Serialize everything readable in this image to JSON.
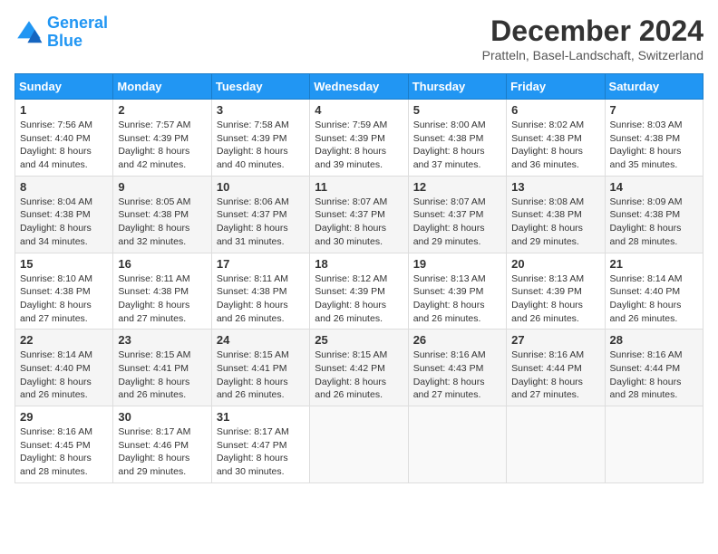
{
  "header": {
    "logo_general": "General",
    "logo_blue": "Blue",
    "month": "December 2024",
    "location": "Pratteln, Basel-Landschaft, Switzerland"
  },
  "columns": [
    "Sunday",
    "Monday",
    "Tuesday",
    "Wednesday",
    "Thursday",
    "Friday",
    "Saturday"
  ],
  "weeks": [
    [
      {
        "day": "1",
        "info": "Sunrise: 7:56 AM\nSunset: 4:40 PM\nDaylight: 8 hours\nand 44 minutes."
      },
      {
        "day": "2",
        "info": "Sunrise: 7:57 AM\nSunset: 4:39 PM\nDaylight: 8 hours\nand 42 minutes."
      },
      {
        "day": "3",
        "info": "Sunrise: 7:58 AM\nSunset: 4:39 PM\nDaylight: 8 hours\nand 40 minutes."
      },
      {
        "day": "4",
        "info": "Sunrise: 7:59 AM\nSunset: 4:39 PM\nDaylight: 8 hours\nand 39 minutes."
      },
      {
        "day": "5",
        "info": "Sunrise: 8:00 AM\nSunset: 4:38 PM\nDaylight: 8 hours\nand 37 minutes."
      },
      {
        "day": "6",
        "info": "Sunrise: 8:02 AM\nSunset: 4:38 PM\nDaylight: 8 hours\nand 36 minutes."
      },
      {
        "day": "7",
        "info": "Sunrise: 8:03 AM\nSunset: 4:38 PM\nDaylight: 8 hours\nand 35 minutes."
      }
    ],
    [
      {
        "day": "8",
        "info": "Sunrise: 8:04 AM\nSunset: 4:38 PM\nDaylight: 8 hours\nand 34 minutes."
      },
      {
        "day": "9",
        "info": "Sunrise: 8:05 AM\nSunset: 4:38 PM\nDaylight: 8 hours\nand 32 minutes."
      },
      {
        "day": "10",
        "info": "Sunrise: 8:06 AM\nSunset: 4:37 PM\nDaylight: 8 hours\nand 31 minutes."
      },
      {
        "day": "11",
        "info": "Sunrise: 8:07 AM\nSunset: 4:37 PM\nDaylight: 8 hours\nand 30 minutes."
      },
      {
        "day": "12",
        "info": "Sunrise: 8:07 AM\nSunset: 4:37 PM\nDaylight: 8 hours\nand 29 minutes."
      },
      {
        "day": "13",
        "info": "Sunrise: 8:08 AM\nSunset: 4:38 PM\nDaylight: 8 hours\nand 29 minutes."
      },
      {
        "day": "14",
        "info": "Sunrise: 8:09 AM\nSunset: 4:38 PM\nDaylight: 8 hours\nand 28 minutes."
      }
    ],
    [
      {
        "day": "15",
        "info": "Sunrise: 8:10 AM\nSunset: 4:38 PM\nDaylight: 8 hours\nand 27 minutes."
      },
      {
        "day": "16",
        "info": "Sunrise: 8:11 AM\nSunset: 4:38 PM\nDaylight: 8 hours\nand 27 minutes."
      },
      {
        "day": "17",
        "info": "Sunrise: 8:11 AM\nSunset: 4:38 PM\nDaylight: 8 hours\nand 26 minutes."
      },
      {
        "day": "18",
        "info": "Sunrise: 8:12 AM\nSunset: 4:39 PM\nDaylight: 8 hours\nand 26 minutes."
      },
      {
        "day": "19",
        "info": "Sunrise: 8:13 AM\nSunset: 4:39 PM\nDaylight: 8 hours\nand 26 minutes."
      },
      {
        "day": "20",
        "info": "Sunrise: 8:13 AM\nSunset: 4:39 PM\nDaylight: 8 hours\nand 26 minutes."
      },
      {
        "day": "21",
        "info": "Sunrise: 8:14 AM\nSunset: 4:40 PM\nDaylight: 8 hours\nand 26 minutes."
      }
    ],
    [
      {
        "day": "22",
        "info": "Sunrise: 8:14 AM\nSunset: 4:40 PM\nDaylight: 8 hours\nand 26 minutes."
      },
      {
        "day": "23",
        "info": "Sunrise: 8:15 AM\nSunset: 4:41 PM\nDaylight: 8 hours\nand 26 minutes."
      },
      {
        "day": "24",
        "info": "Sunrise: 8:15 AM\nSunset: 4:41 PM\nDaylight: 8 hours\nand 26 minutes."
      },
      {
        "day": "25",
        "info": "Sunrise: 8:15 AM\nSunset: 4:42 PM\nDaylight: 8 hours\nand 26 minutes."
      },
      {
        "day": "26",
        "info": "Sunrise: 8:16 AM\nSunset: 4:43 PM\nDaylight: 8 hours\nand 27 minutes."
      },
      {
        "day": "27",
        "info": "Sunrise: 8:16 AM\nSunset: 4:44 PM\nDaylight: 8 hours\nand 27 minutes."
      },
      {
        "day": "28",
        "info": "Sunrise: 8:16 AM\nSunset: 4:44 PM\nDaylight: 8 hours\nand 28 minutes."
      }
    ],
    [
      {
        "day": "29",
        "info": "Sunrise: 8:16 AM\nSunset: 4:45 PM\nDaylight: 8 hours\nand 28 minutes."
      },
      {
        "day": "30",
        "info": "Sunrise: 8:17 AM\nSunset: 4:46 PM\nDaylight: 8 hours\nand 29 minutes."
      },
      {
        "day": "31",
        "info": "Sunrise: 8:17 AM\nSunset: 4:47 PM\nDaylight: 8 hours\nand 30 minutes."
      },
      null,
      null,
      null,
      null
    ]
  ]
}
